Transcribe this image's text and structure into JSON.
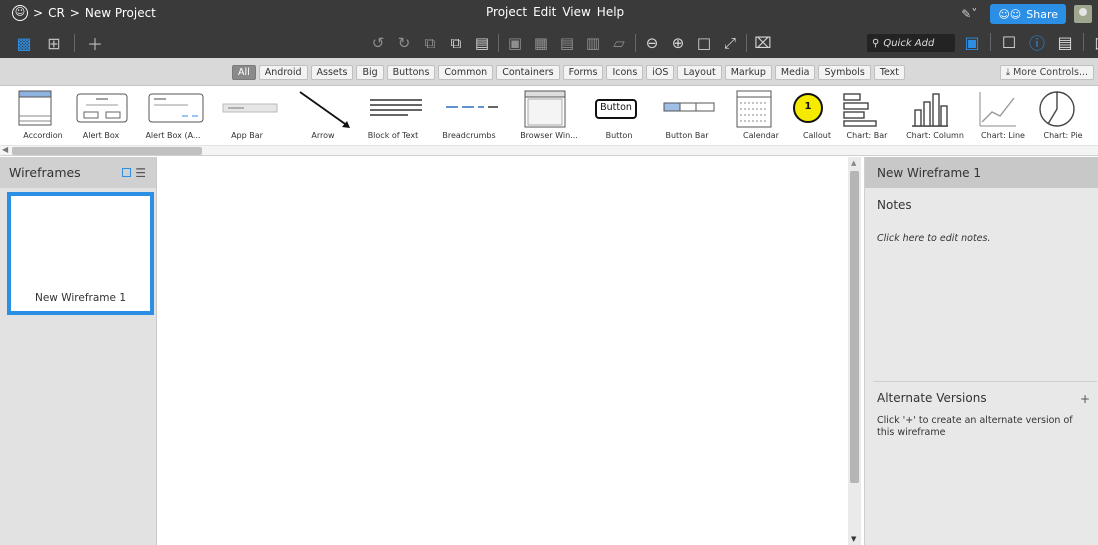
{
  "titlebar": {
    "breadcrumb_sep1": ">",
    "project_group": "CR",
    "breadcrumb_sep2": ">",
    "project_name": "New Project",
    "menu": [
      "Project",
      "Edit",
      "View",
      "Help"
    ],
    "share_label": "Share"
  },
  "toolbar": {
    "quick_add_placeholder": "Quick Add"
  },
  "filters": {
    "chips": [
      "All",
      "Android",
      "Assets",
      "Big",
      "Buttons",
      "Common",
      "Containers",
      "Forms",
      "Icons",
      "iOS",
      "Layout",
      "Markup",
      "Media",
      "Symbols",
      "Text"
    ],
    "active": "All",
    "more_controls": "More Controls..."
  },
  "controls": {
    "items": [
      "Accordion",
      "Alert Box",
      "Alert Box (A...",
      "App Bar",
      "Arrow",
      "Block of Text",
      "Breadcrumbs",
      "Browser Win...",
      "Button",
      "Button Bar",
      "Calendar",
      "Callout",
      "Chart: Bar",
      "Chart: Column",
      "Chart: Line",
      "Chart: Pie"
    ],
    "button_text": "Button",
    "callout_number": "1"
  },
  "left_panel": {
    "title": "Wireframes",
    "wireframes": [
      "New Wireframe 1"
    ]
  },
  "right_panel": {
    "title": "New Wireframe 1",
    "notes_title": "Notes",
    "notes_hint": "Click here to edit notes.",
    "alt_title": "Alternate Versions",
    "alt_plus": "+",
    "alt_hint": "Click '+' to create an alternate version of this wireframe"
  }
}
